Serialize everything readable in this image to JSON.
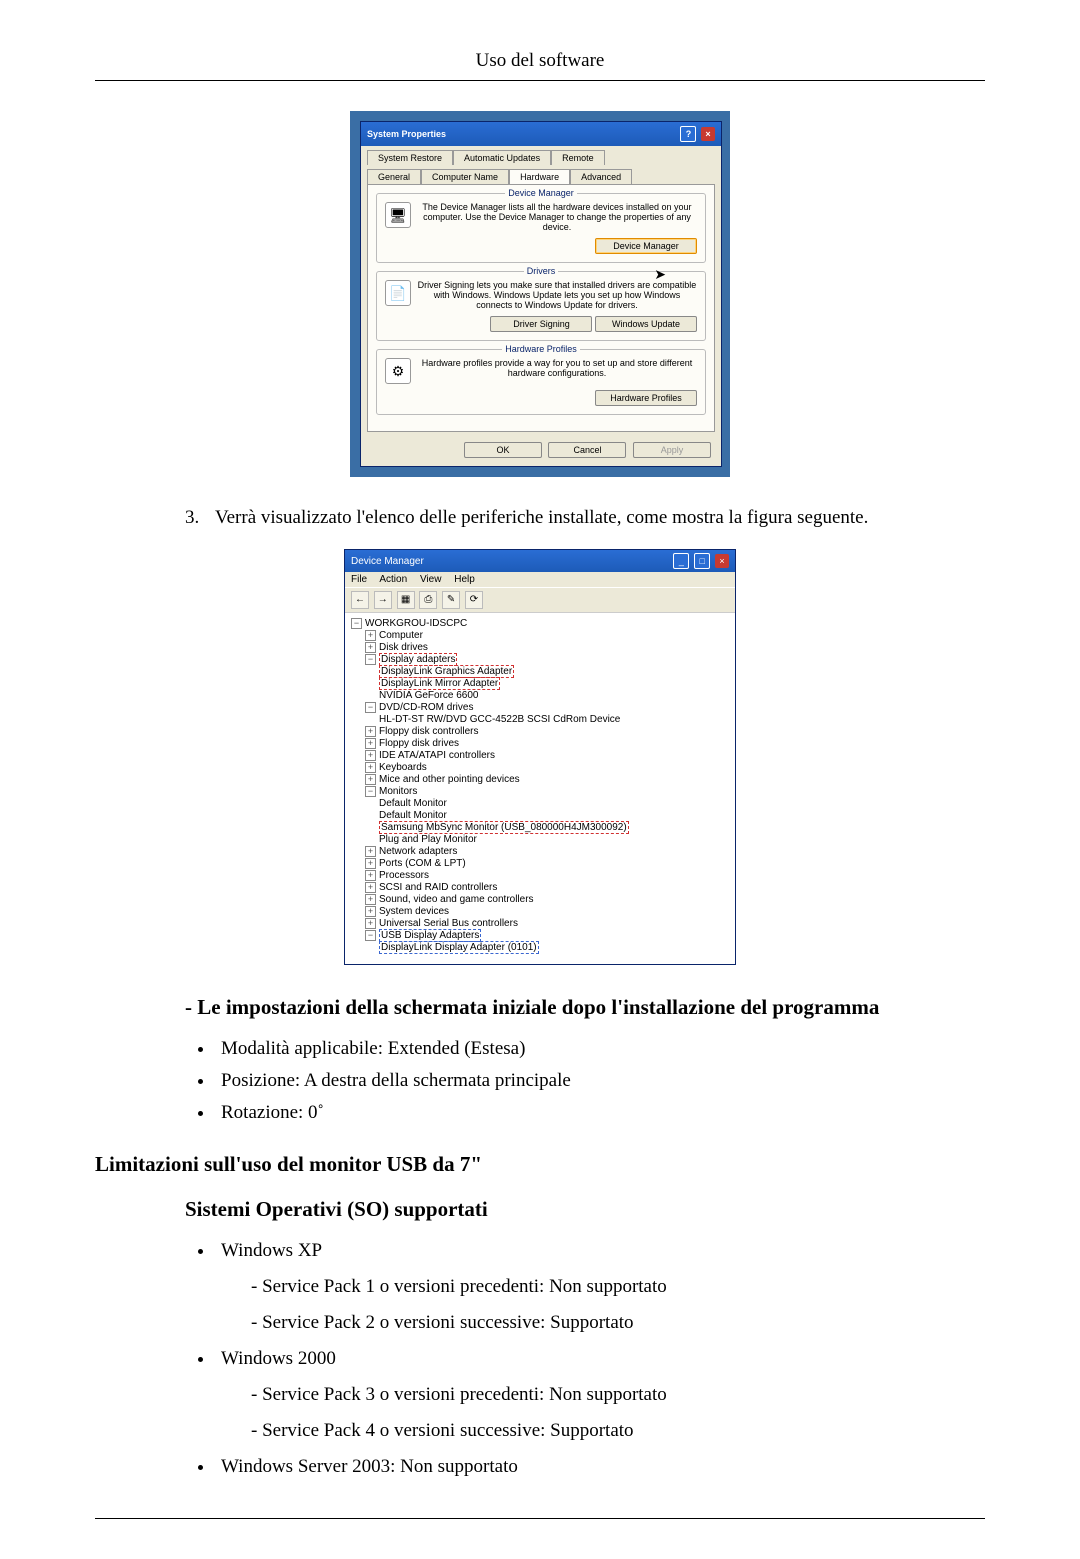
{
  "header": {
    "title": "Uso del software"
  },
  "step": {
    "number": "3.",
    "text": "Verrà visualizzato l'elenco delle periferiche installate, come mostra la figura seguente."
  },
  "section_initial": "- Le impostazioni della schermata iniziale dopo l'installazione del programma",
  "initial_bullets": {
    "b1": "Modalità applicabile: Extended (Estesa)",
    "b2": "Posizione: A destra della schermata principale",
    "b3": "Rotazione: 0˚"
  },
  "limitations_heading": "Limitazioni sull'uso del monitor USB da 7\"",
  "supported_os_heading": "Sistemi Operativi (SO) supportati",
  "os": {
    "xp": {
      "name": "Windows XP",
      "s1": "- Service Pack 1 o versioni precedenti: Non supportato",
      "s2": "- Service Pack 2 o versioni successive: Supportato"
    },
    "w2000": {
      "name": "Windows 2000",
      "s1": "- Service Pack 3 o versioni precedenti: Non supportato",
      "s2": "- Service Pack 4 o versioni successive: Supportato"
    },
    "w2003": "Windows Server 2003: Non supportato"
  },
  "sysprops": {
    "title": "System Properties",
    "tabs": {
      "sr": "System Restore",
      "au": "Automatic Updates",
      "remote": "Remote",
      "general": "General",
      "cname": "Computer Name",
      "hardware": "Hardware",
      "advanced": "Advanced"
    },
    "dm": {
      "group": "Device Manager",
      "text": "The Device Manager lists all the hardware devices installed on your computer. Use the Device Manager to change the properties of any device.",
      "btn": "Device Manager"
    },
    "drv": {
      "group": "Drivers",
      "text": "Driver Signing lets you make sure that installed drivers are compatible with Windows. Windows Update lets you set up how Windows connects to Windows Update for drivers.",
      "btn1": "Driver Signing",
      "btn2": "Windows Update"
    },
    "hp": {
      "group": "Hardware Profiles",
      "text": "Hardware profiles provide a way for you to set up and store different hardware configurations.",
      "btn": "Hardware Profiles"
    },
    "footer": {
      "ok": "OK",
      "cancel": "Cancel",
      "apply": "Apply"
    }
  },
  "devmgr": {
    "title": "Device Manager",
    "menu": {
      "file": "File",
      "action": "Action",
      "view": "View",
      "help": "Help"
    },
    "root": "WORKGROU-IDSCPC",
    "nodes": {
      "computer": "Computer",
      "disk": "Disk drives",
      "display": "Display adapters",
      "display_items": {
        "a": "DisplayLink Graphics Adapter",
        "b": "DisplayLink Mirror Adapter",
        "c": "NVIDIA GeForce 6600"
      },
      "dvd": "DVD/CD-ROM drives",
      "dvd_item": "HL-DT-ST RW/DVD GCC-4522B SCSI CdRom Device",
      "floppyctrl": "Floppy disk controllers",
      "floppy": "Floppy disk drives",
      "ide": "IDE ATA/ATAPI controllers",
      "kb": "Keyboards",
      "mice": "Mice and other pointing devices",
      "monitors": "Monitors",
      "mon_items": {
        "a": "Default Monitor",
        "b": "Default Monitor",
        "c": "Samsung MbSync Monitor (USB_080000H4JM300092)",
        "d": "Plug and Play Monitor"
      },
      "net": "Network adapters",
      "ports": "Ports (COM & LPT)",
      "proc": "Processors",
      "scsi": "SCSI and RAID controllers",
      "sound": "Sound, video and game controllers",
      "sysdev": "System devices",
      "usbctrl": "Universal Serial Bus controllers",
      "usbdisp": "USB Display Adapters",
      "usbdisp_item": "DisplayLink Display Adapter (0101)"
    }
  }
}
